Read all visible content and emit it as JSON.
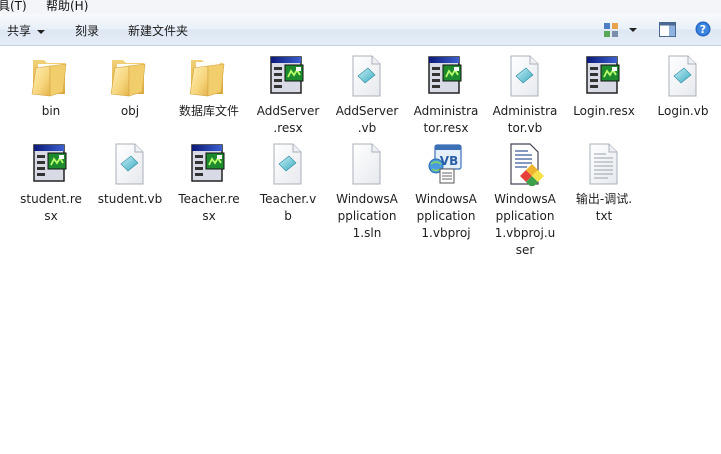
{
  "menu": {
    "tools": "具(T)",
    "help": "帮助(H)"
  },
  "toolbar": {
    "share": "共享",
    "burn": "刻录",
    "new_folder": "新建文件夹"
  },
  "files": [
    {
      "name": "bin",
      "label": "bin",
      "icon": "folder"
    },
    {
      "name": "obj",
      "label": "obj",
      "icon": "folder"
    },
    {
      "name": "数据库文件",
      "label": "数据库文件",
      "icon": "folder"
    },
    {
      "name": "AddServer.resx",
      "label": "AddServer\n.resx",
      "icon": "resx"
    },
    {
      "name": "AddServer.vb",
      "label": "AddServer\n.vb",
      "icon": "vb-file"
    },
    {
      "name": "Administrator.resx",
      "label": "Administra\ntor.resx",
      "icon": "resx"
    },
    {
      "name": "Administrator.vb",
      "label": "Administra\ntor.vb",
      "icon": "vb-file"
    },
    {
      "name": "Login.resx",
      "label": "Login.resx",
      "icon": "resx"
    },
    {
      "name": "Login.vb",
      "label": "Login.vb",
      "icon": "vb-file"
    },
    {
      "name": "student.resx",
      "label": "student.re\nsx",
      "icon": "resx"
    },
    {
      "name": "student.vb",
      "label": "student.vb",
      "icon": "vb-file"
    },
    {
      "name": "Teacher.resx",
      "label": "Teacher.re\nsx",
      "icon": "resx"
    },
    {
      "name": "Teacher.vb",
      "label": "Teacher.v\nb",
      "icon": "vb-file"
    },
    {
      "name": "WindowsApplication1.sln",
      "label": "WindowsA\npplication\n1.sln",
      "icon": "blank-file"
    },
    {
      "name": "WindowsApplication1.vbproj",
      "label": "WindowsA\npplication\n1.vbproj",
      "icon": "vbproj"
    },
    {
      "name": "WindowsApplication1.vbproj.user",
      "label": "WindowsA\npplication\n1.vbproj.u\nser",
      "icon": "vbproj-user"
    },
    {
      "name": "输出-调试.txt",
      "label": "输出-调试.\ntxt",
      "icon": "txt-file"
    }
  ]
}
